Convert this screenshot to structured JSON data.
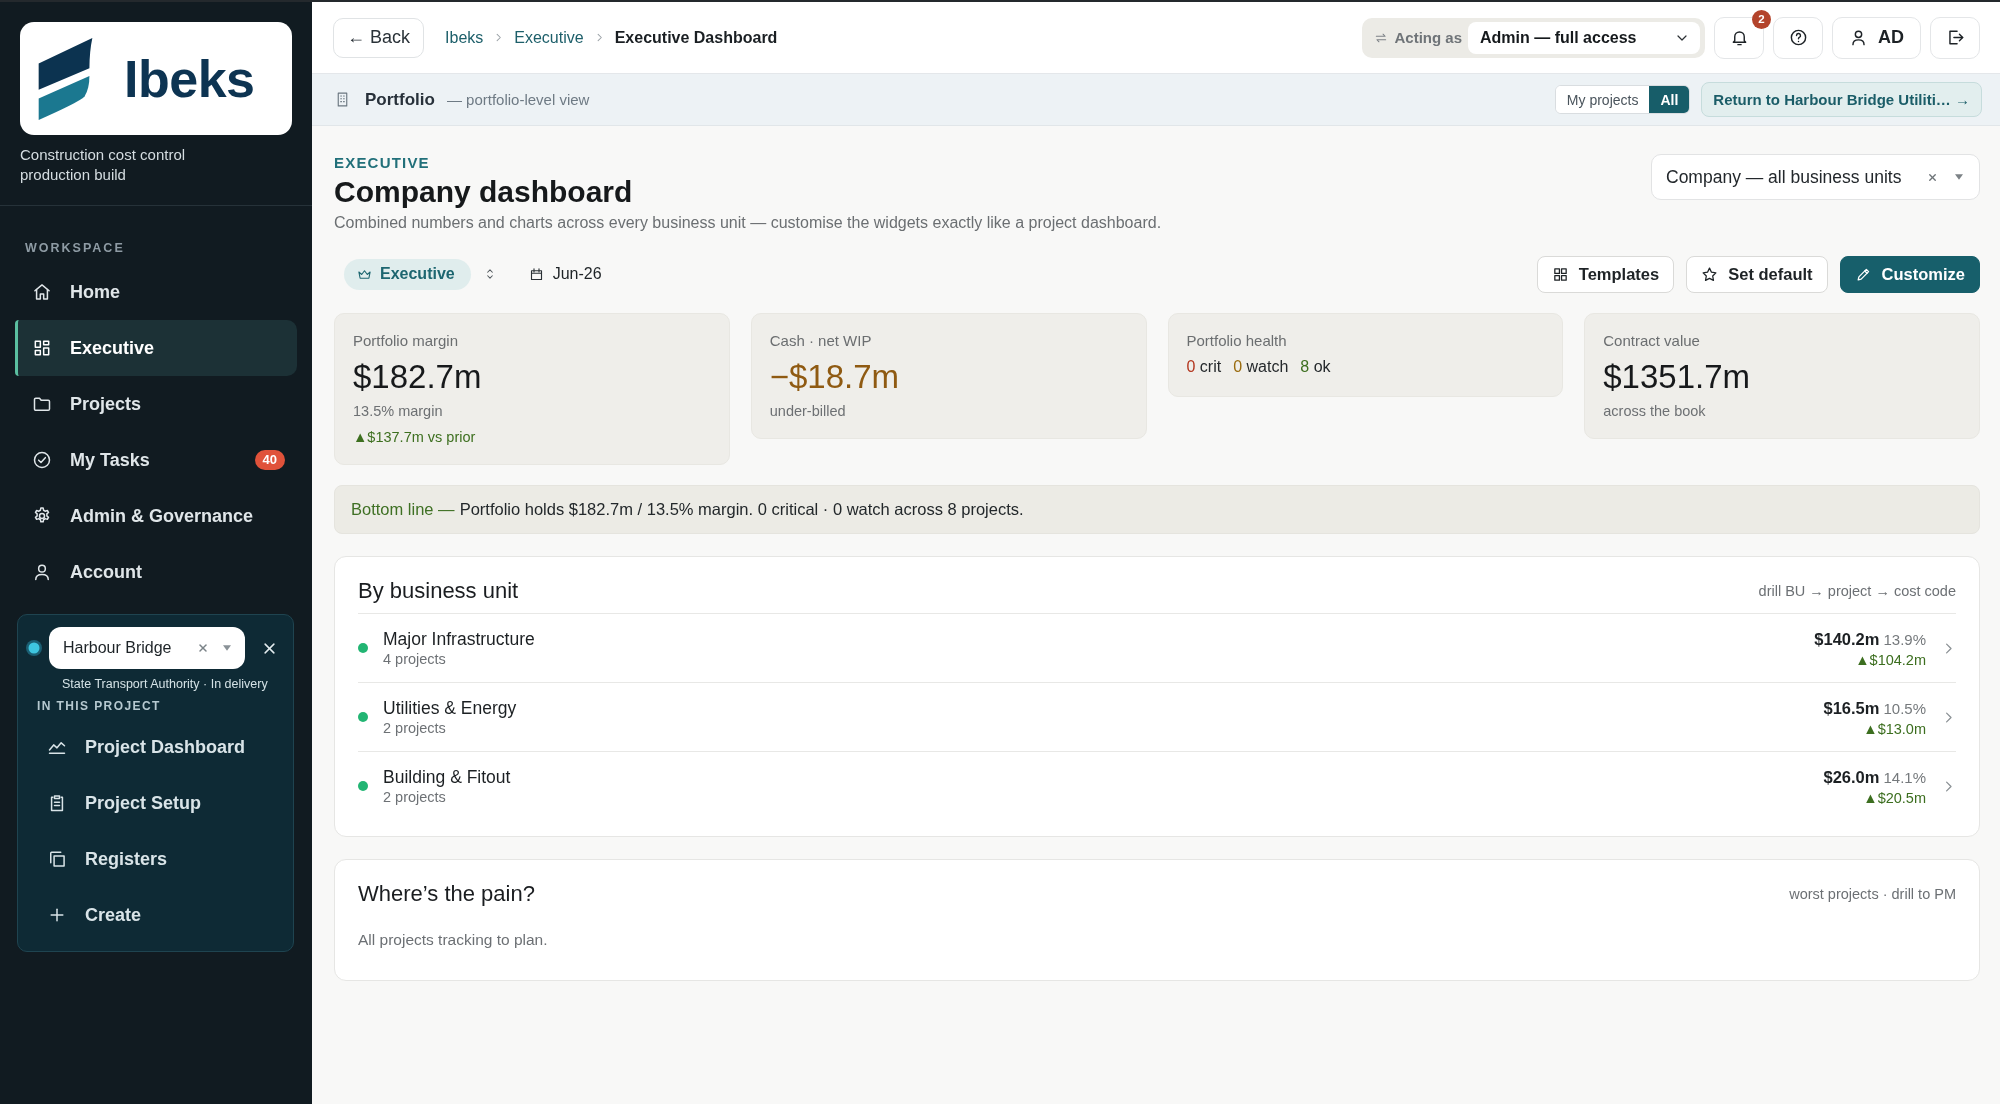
{
  "sidebar": {
    "brand": "Ibeks",
    "tagline": "Construction cost control",
    "build": "production build",
    "section_label": "WORKSPACE",
    "nav": [
      {
        "label": "Home",
        "selected": false
      },
      {
        "label": "Executive",
        "selected": true
      },
      {
        "label": "Projects",
        "selected": false
      },
      {
        "label": "My Tasks",
        "selected": false,
        "badge": "40"
      },
      {
        "label": "Admin & Governance",
        "selected": false
      },
      {
        "label": "Account",
        "selected": false
      }
    ],
    "project": {
      "name": "Harbour Bridge",
      "meta": "State Transport Authority · In delivery",
      "section_label": "IN THIS PROJECT",
      "items": [
        {
          "label": "Project Dashboard",
          "selected": false
        },
        {
          "label": "Project Setup",
          "selected": false
        },
        {
          "label": "Registers",
          "selected": false
        },
        {
          "label": "Create",
          "selected": false
        }
      ]
    }
  },
  "topbar": {
    "back": "← Back",
    "breadcrumbs": [
      {
        "label": "Ibeks",
        "current": false
      },
      {
        "label": "Executive",
        "current": false
      },
      {
        "label": "Executive Dashboard",
        "current": true
      }
    ],
    "acting_as": {
      "label": "Acting as",
      "value": "Admin — full access"
    },
    "notifications": "2",
    "user": "AD"
  },
  "portfolio_bar": {
    "title": "Portfolio",
    "subtitle": "— portfolio-level view",
    "scope": [
      {
        "label": "My projects",
        "selected": false
      },
      {
        "label": "All",
        "selected": true
      }
    ],
    "return_link": "Return to Harbour Bridge Utiliti… →"
  },
  "header": {
    "eyebrow": "EXECUTIVE",
    "title": "Company dashboard",
    "description": "Combined numbers and charts across every business unit — customise the widgets exactly like a project dashboard.",
    "scope_select": "Company — all business units"
  },
  "toolbar": {
    "view": "Executive",
    "period": "Jun-26",
    "buttons": [
      {
        "label": "Templates",
        "kind": "secondary"
      },
      {
        "label": "Set default",
        "kind": "secondary"
      },
      {
        "label": "Customize",
        "kind": "primary"
      }
    ]
  },
  "kpis": [
    {
      "kind": "value",
      "label": "Portfolio margin",
      "value": "$182.7m",
      "negative": false,
      "note": "13.5% margin",
      "delta": "▲$137.7m vs prior"
    },
    {
      "kind": "value",
      "label": "Cash · net WIP",
      "value": "−$18.7m",
      "negative": true,
      "note": "under-billed"
    },
    {
      "kind": "health",
      "label": "Portfolio health",
      "counts": [
        {
          "count": "0",
          "label": "crit",
          "kind": "critical"
        },
        {
          "count": "0",
          "label": "watch",
          "kind": "watch"
        },
        {
          "count": "8",
          "label": "ok",
          "kind": "ok"
        }
      ]
    },
    {
      "kind": "value",
      "label": "Contract value",
      "value": "$1351.7m",
      "negative": false,
      "note": "across the book"
    }
  ],
  "bottom_line": {
    "lead": "Bottom line —",
    "text": "Portfolio holds $182.7m / 13.5% margin. 0 critical · 0 watch across 8 projects."
  },
  "business_units": {
    "title": "By business unit",
    "hint": "drill BU → project → cost code",
    "rows": [
      {
        "name": "Major Infrastructure",
        "projects": "4 projects",
        "color": "#22b573",
        "value": "$140.2m",
        "percent": "13.9%",
        "delta": "▲$104.2m"
      },
      {
        "name": "Utilities & Energy",
        "projects": "2 projects",
        "color": "#22b573",
        "value": "$16.5m",
        "percent": "10.5%",
        "delta": "▲$13.0m"
      },
      {
        "name": "Building & Fitout",
        "projects": "2 projects",
        "color": "#22b573",
        "value": "$26.0m",
        "percent": "14.1%",
        "delta": "▲$20.5m"
      }
    ]
  },
  "pain": {
    "title": "Where’s the pain?",
    "hint": "worst projects · drill to PM",
    "empty": "All projects tracking to plan."
  }
}
